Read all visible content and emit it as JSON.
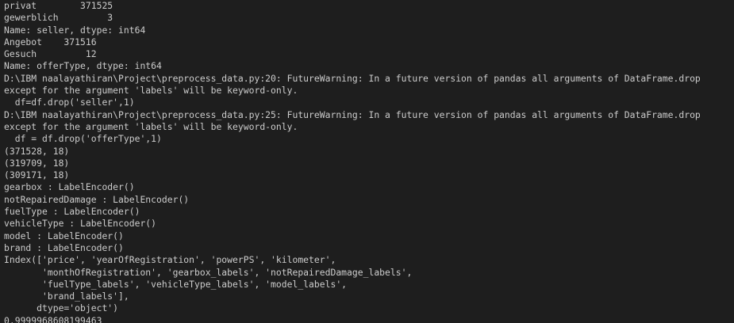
{
  "terminal": {
    "lines": [
      "privat        371525",
      "gewerblich         3",
      "Name: seller, dtype: int64",
      "Angebot    371516",
      "Gesuch         12",
      "Name: offerType, dtype: int64",
      "D:\\IBM naalayathiran\\Project\\preprocess_data.py:20: FutureWarning: In a future version of pandas all arguments of DataFrame.drop",
      "except for the argument 'labels' will be keyword-only.",
      "  df=df.drop('seller',1)",
      "D:\\IBM naalayathiran\\Project\\preprocess_data.py:25: FutureWarning: In a future version of pandas all arguments of DataFrame.drop",
      "except for the argument 'labels' will be keyword-only.",
      "  df = df.drop('offerType',1)",
      "(371528, 18)",
      "(319709, 18)",
      "(309171, 18)",
      "gearbox : LabelEncoder()",
      "notRepairedDamage : LabelEncoder()",
      "fuelType : LabelEncoder()",
      "vehicleType : LabelEncoder()",
      "model : LabelEncoder()",
      "brand : LabelEncoder()",
      "Index(['price', 'yearOfRegistration', 'powerPS', 'kilometer',",
      "       'monthOfRegistration', 'gearbox_labels', 'notRepairedDamage_labels',",
      "       'fuelType_labels', 'vehicleType_labels', 'model_labels',",
      "       'brand_labels'],",
      "      dtype='object')",
      "0.9999968608199463"
    ]
  },
  "colors": {
    "background": "#1e1e1e",
    "text": "#cccccc"
  }
}
